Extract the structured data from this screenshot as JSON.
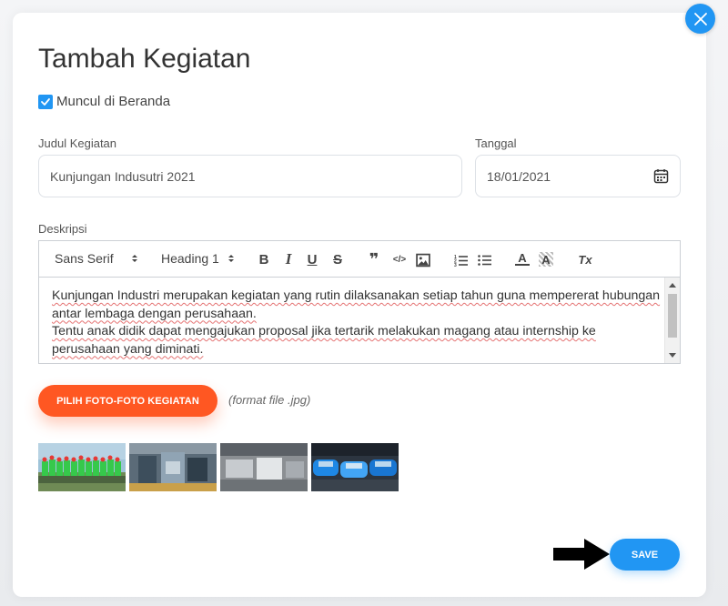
{
  "modal": {
    "title": "Tambah Kegiatan",
    "show_on_home": {
      "label": "Muncul di Beranda",
      "checked": true
    }
  },
  "form": {
    "title_field": {
      "label": "Judul Kegiatan",
      "value": "Kunjungan Indusutri 2021"
    },
    "date_field": {
      "label": "Tanggal",
      "value": "18/01/2021"
    },
    "description": {
      "label": "Deskripsi",
      "toolbar": {
        "font": "Sans Serif",
        "heading": "Heading 1",
        "bold_glyph": "B",
        "italic_glyph": "I",
        "underline_glyph": "U",
        "strike_glyph": "S",
        "quote_glyph": "❞",
        "code_glyph": "</>",
        "color_glyph": "A",
        "bg_glyph": "A",
        "clear_glyph": "Tx"
      },
      "lines": [
        "Kunjungan Industri merupakan kegiatan yang rutin dilaksanakan setiap tahun guna mempererat hubungan antar lembaga dengan perusahaan.",
        "Tentu anak didik dapat mengajukan proposal jika tertarik melakukan magang atau internship ke perusahaan yang diminati."
      ]
    }
  },
  "photos": {
    "button_label": "PILIH FOTO-FOTO KEGIATAN",
    "format_hint": "(format file .jpg)",
    "thumbnails": [
      "group-photo",
      "factory-machinery",
      "factory-floor",
      "parked-cars"
    ]
  },
  "actions": {
    "save_label": "SAVE"
  },
  "colors": {
    "primary": "#2196f3",
    "accent": "#ff5722"
  },
  "icons": [
    "close-icon",
    "check-icon",
    "calendar-icon",
    "image-icon",
    "ordered-list-icon",
    "bullet-list-icon",
    "arrow-right-icon"
  ]
}
